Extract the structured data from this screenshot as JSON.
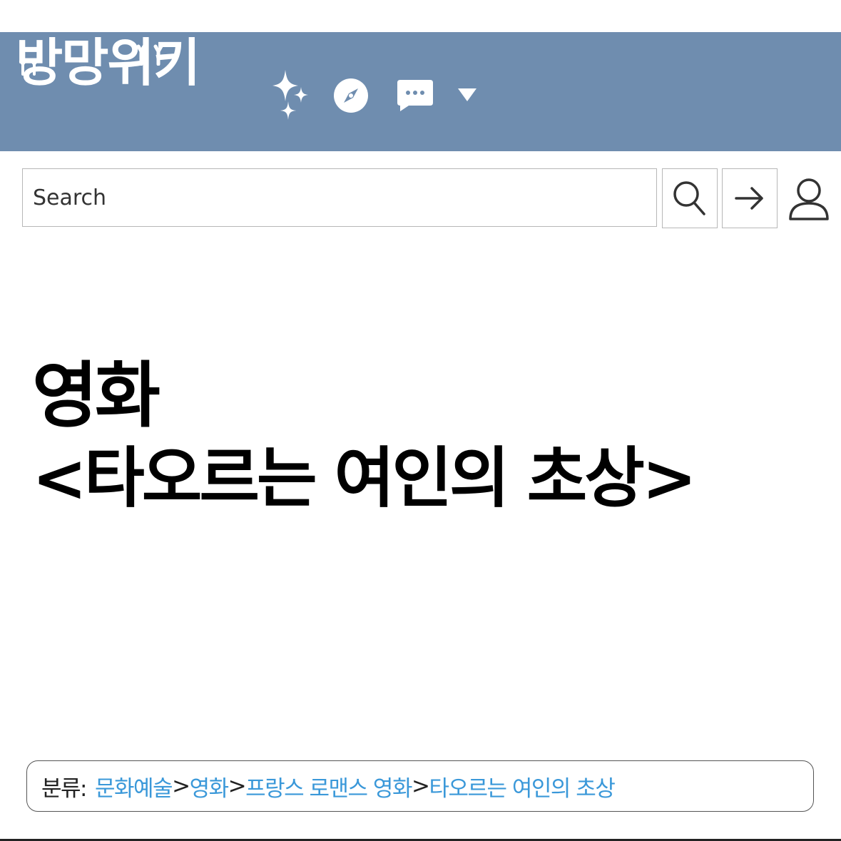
{
  "header": {
    "logo_text": "방망위키",
    "icons": [
      "sparkle-icon",
      "compass-icon",
      "chat-bubble-icon",
      "dropdown-arrow-icon"
    ],
    "background_color": "#6f8daf"
  },
  "search": {
    "placeholder": "Search",
    "buttons": [
      "search-icon",
      "arrow-right-icon",
      "user-icon"
    ]
  },
  "article": {
    "title_line1": "영화",
    "title_line2": "<타오르는 여인의 초상>"
  },
  "category": {
    "label": "분류:",
    "separator": ">",
    "items": [
      "문화예술",
      "영화",
      "프랑스 로맨스 영화",
      "타오르는 여인의 초상"
    ],
    "link_color": "#3a98d9"
  }
}
